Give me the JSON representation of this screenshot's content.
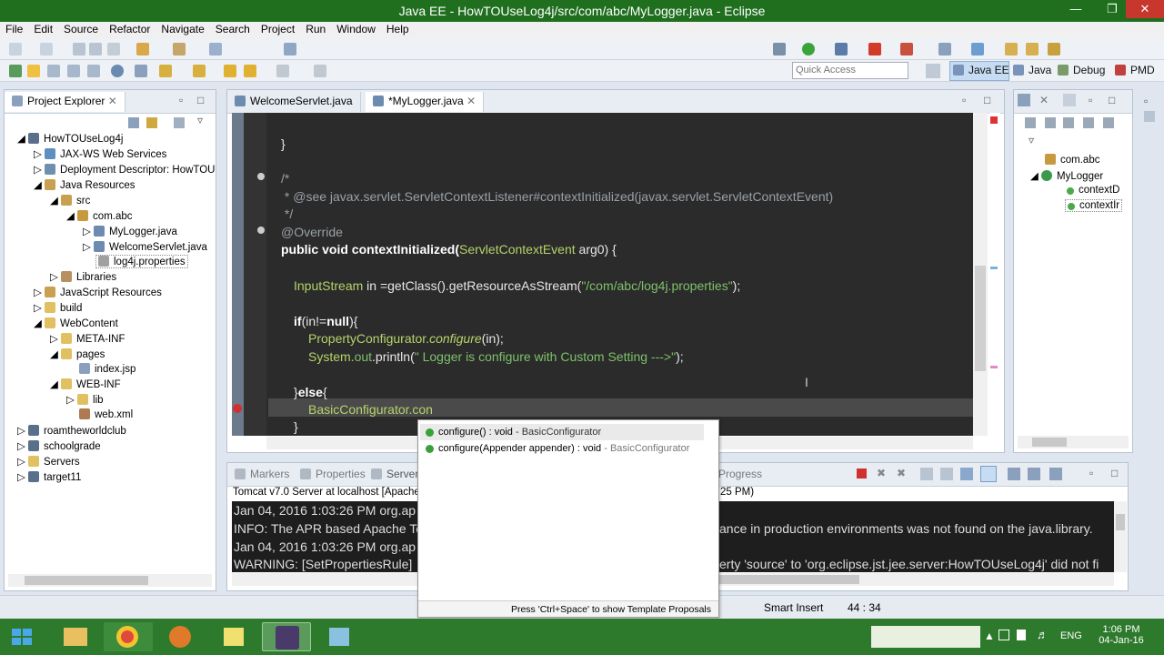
{
  "window": {
    "title": "Java EE - HowTOUseLog4j/src/com/abc/MyLogger.java - Eclipse"
  },
  "menu": [
    "File",
    "Edit",
    "Source",
    "Refactor",
    "Navigate",
    "Search",
    "Project",
    "Run",
    "Window",
    "Help"
  ],
  "quick_access": "Quick Access",
  "perspectives": [
    "Java EE",
    "Java",
    "Debug",
    "PMD"
  ],
  "explorer": {
    "title": "Project Explorer",
    "items": [
      {
        "label": "HowTOUseLog4j",
        "icon": "project-icon"
      },
      {
        "label": "JAX-WS Web Services",
        "icon": "webservice-icon"
      },
      {
        "label": "Deployment Descriptor: HowTOU",
        "icon": "descriptor-icon"
      },
      {
        "label": "Java Resources",
        "icon": "java-resources-icon"
      },
      {
        "label": "src",
        "icon": "source-folder-icon"
      },
      {
        "label": "com.abc",
        "icon": "package-icon"
      },
      {
        "label": "MyLogger.java",
        "icon": "java-file-icon"
      },
      {
        "label": "WelcomeServlet.java",
        "icon": "java-file-icon"
      },
      {
        "label": "log4j.properties",
        "icon": "properties-file-icon"
      },
      {
        "label": "Libraries",
        "icon": "library-icon"
      },
      {
        "label": "JavaScript Resources",
        "icon": "js-resources-icon"
      },
      {
        "label": "build",
        "icon": "folder-icon"
      },
      {
        "label": "WebContent",
        "icon": "folder-icon"
      },
      {
        "label": "META-INF",
        "icon": "folder-icon"
      },
      {
        "label": "pages",
        "icon": "folder-icon"
      },
      {
        "label": "index.jsp",
        "icon": "jsp-file-icon"
      },
      {
        "label": "WEB-INF",
        "icon": "folder-icon"
      },
      {
        "label": "lib",
        "icon": "folder-icon"
      },
      {
        "label": "web.xml",
        "icon": "xml-file-icon"
      },
      {
        "label": "roamtheworldclub",
        "icon": "project-icon"
      },
      {
        "label": "schoolgrade",
        "icon": "project-icon"
      },
      {
        "label": "Servers",
        "icon": "folder-icon"
      },
      {
        "label": "target11",
        "icon": "project-icon"
      }
    ]
  },
  "editor": {
    "tabs": [
      "WelcomeServlet.java",
      "*MyLogger.java"
    ],
    "lines": {
      "l1": "}",
      "l2": "/*",
      "l3a": " * @see ",
      "l3b": "javax.servlet.ServletContextListener#contextInitialized(javax.servlet.ServletContextEvent)",
      "l4": " */",
      "l5": "@Override",
      "l6a": "public void ",
      "l6b": "contextInitialized(",
      "l6c": "ServletContextEvent",
      "l6d": " arg0) {",
      "l7a": "InputStream",
      "l7b": " in =getClass().getResourceAsStream(",
      "l7c": "\"/com/abc/log4j.properties\"",
      "l7d": ");",
      "l8a": "if",
      "l8b": "(in!=",
      "l8c": "null",
      "l8d": "){",
      "l9a": "PropertyConfigurator.",
      "l9b": "configure",
      "l9c": "(in);",
      "l10a": "System.",
      "l10b": "out",
      "l10c": ".println(",
      "l10d": "\" Logger is configure with Custom Setting --->\"",
      "l10e": ");",
      "l11a": "}",
      "l11b": "else",
      "l11c": "{",
      "l12": "BasicConfigurator.con",
      "l13": "}"
    }
  },
  "completion": {
    "items": [
      {
        "sig": "configure() : void",
        "cls": " - BasicConfigurator"
      },
      {
        "sig": "configure(Appender appender) : void",
        "cls": " - BasicConfigurator"
      }
    ],
    "hint": "Press 'Ctrl+Space' to show Template Proposals"
  },
  "outline": {
    "items": [
      "com.abc",
      "MyLogger",
      "contextD",
      "contextIr"
    ]
  },
  "bottom": {
    "tabs": [
      "Markers",
      "Properties",
      "Servers",
      "Progress"
    ],
    "server_left": "Tomcat v7.0 Server at localhost [Apache T",
    "server_right": "25 PM)",
    "console_left": [
      "Jan 04, 2016 1:03:26 PM org.ap",
      "INFO: The APR based Apache Tc",
      "Jan 04, 2016 1:03:26 PM org.ap",
      "WARNING: [SetPropertiesRule]"
    ],
    "console_right": [
      "",
      "ance in production environments was not found on the java.library.",
      "",
      "erty 'source' to 'org.eclipse.jst.jee.server:HowTOUseLog4j' did not fi"
    ]
  },
  "status": {
    "mode": "Smart Insert",
    "position": "44 : 34"
  },
  "taskbar": {
    "lang": "ENG",
    "time": "1:06 PM",
    "date": "04-Jan-16"
  }
}
